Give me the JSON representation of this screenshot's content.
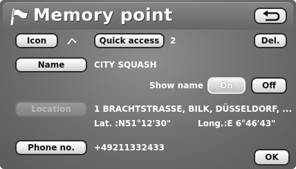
{
  "header": {
    "title": "Memory point",
    "back_icon": "return-arrow-icon",
    "flag_icon": "flag-icon"
  },
  "buttons": {
    "icon": "Icon",
    "quick_access": "Quick access",
    "delete": "Del.",
    "name": "Name",
    "on": "On",
    "off": "Off",
    "location": "Location",
    "phone": "Phone no.",
    "ok": "OK"
  },
  "values": {
    "quick_access_number": "2",
    "name": "CITY SQUASH",
    "show_name_label": "Show name",
    "address": "1 BRACHTSTRASSE, BILK, DÜSSELDORF, ...",
    "lat": "Lat. :N51°12'30\"",
    "long": "Long.:E  6°46'43\"",
    "phone": "+49211332433"
  },
  "state": {
    "show_name": "On",
    "location_enabled": false
  }
}
